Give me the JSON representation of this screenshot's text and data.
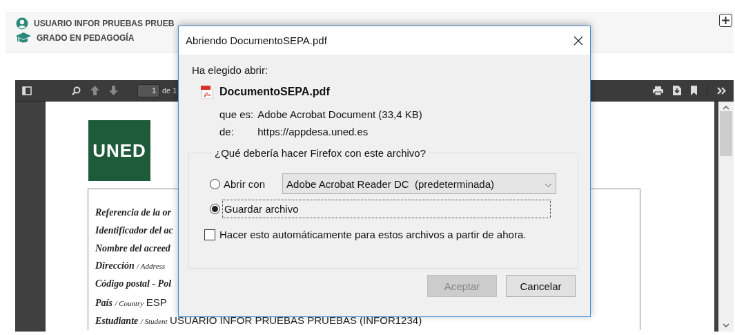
{
  "header": {
    "user_name": "USUARIO INFOR  PRUEBAS  PRUEB",
    "degree": "GRADO EN PEDAGOGÍA"
  },
  "pdf_viewer": {
    "toolbar": {
      "page_number": "1",
      "page_count": "de 1"
    },
    "document": {
      "logo_text": "UNED",
      "rows": [
        {
          "label": "Referencia de la or",
          "sublabel": "",
          "value": ""
        },
        {
          "label": "Identificador del ac",
          "sublabel": "",
          "value": ""
        },
        {
          "label": "Nombre del acreed",
          "sublabel": "",
          "value": ""
        },
        {
          "label": "Dirección",
          "sublabel": "/ Address",
          "value": ""
        },
        {
          "label": "Código postal - Pol",
          "sublabel": "",
          "value": ""
        },
        {
          "label": "País",
          "sublabel": "/ Country",
          "value": "ESP"
        },
        {
          "label": "Estudiante",
          "sublabel": "/ Student",
          "value": "USUARIO INFOR PRUEBAS PRUEBAS (INFOR1234)"
        }
      ]
    }
  },
  "dialog": {
    "title": "Abriendo DocumentoSEPA.pdf",
    "intro": "Ha elegido abrir:",
    "file_name": "DocumentoSEPA.pdf",
    "details": [
      {
        "label": "que es:",
        "value": "Adobe Acrobat Document (33,4 KB)"
      },
      {
        "label": "de:",
        "value": "https://appdesa.uned.es"
      }
    ],
    "group_label": "¿Qué debería hacer Firefox con este archivo?",
    "options": [
      {
        "kind": "dropdown",
        "label": "Abrir con",
        "selected": false,
        "app": "Adobe Acrobat Reader DC  (predeterminada)"
      },
      {
        "kind": "plain",
        "label": "Guardar archivo",
        "selected": true
      }
    ],
    "remember": {
      "label": "Hacer esto automáticamente para estos archivos a partir de ahora.",
      "checked": false
    },
    "buttons": [
      {
        "label": "Aceptar",
        "disabled": true
      },
      {
        "label": "Cancelar",
        "disabled": false
      }
    ]
  }
}
